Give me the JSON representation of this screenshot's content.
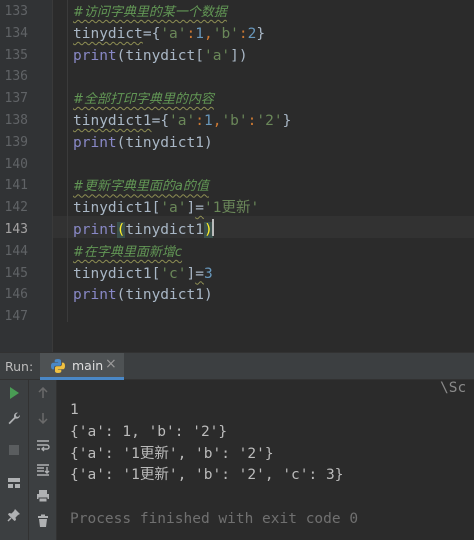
{
  "editor": {
    "lines": [
      {
        "num": "133",
        "tokens": [
          {
            "t": "#访问字典里的某一个数据",
            "c": "comment wavy"
          }
        ]
      },
      {
        "num": "134",
        "tokens": [
          {
            "t": "tinydict",
            "c": "ident wavy"
          },
          {
            "t": "=",
            "c": "op"
          },
          {
            "t": "{",
            "c": "op"
          },
          {
            "t": "'a'",
            "c": "str"
          },
          {
            "t": ":",
            "c": "punc"
          },
          {
            "t": "1",
            "c": "num"
          },
          {
            "t": ",",
            "c": "punc"
          },
          {
            "t": "'b'",
            "c": "str"
          },
          {
            "t": ":",
            "c": "punc"
          },
          {
            "t": "2",
            "c": "num"
          },
          {
            "t": "}",
            "c": "op"
          }
        ]
      },
      {
        "num": "135",
        "tokens": [
          {
            "t": "print",
            "c": "builtin"
          },
          {
            "t": "(",
            "c": "op"
          },
          {
            "t": "tinydict",
            "c": "ident"
          },
          {
            "t": "[",
            "c": "op"
          },
          {
            "t": "'a'",
            "c": "str"
          },
          {
            "t": "])",
            "c": "op"
          }
        ]
      },
      {
        "num": "136",
        "tokens": []
      },
      {
        "num": "137",
        "tokens": [
          {
            "t": "#全部打印字典里的内容",
            "c": "comment wavy"
          }
        ]
      },
      {
        "num": "138",
        "tokens": [
          {
            "t": "tinydict1",
            "c": "ident wavy"
          },
          {
            "t": "=",
            "c": "op"
          },
          {
            "t": "{",
            "c": "op"
          },
          {
            "t": "'a'",
            "c": "str"
          },
          {
            "t": ":",
            "c": "punc"
          },
          {
            "t": "1",
            "c": "num"
          },
          {
            "t": ",",
            "c": "punc"
          },
          {
            "t": "'b'",
            "c": "str"
          },
          {
            "t": ":",
            "c": "punc"
          },
          {
            "t": "'2'",
            "c": "str"
          },
          {
            "t": "}",
            "c": "op"
          }
        ]
      },
      {
        "num": "139",
        "tokens": [
          {
            "t": "print",
            "c": "builtin"
          },
          {
            "t": "(",
            "c": "op"
          },
          {
            "t": "tinydict1",
            "c": "ident"
          },
          {
            "t": ")",
            "c": "op"
          }
        ]
      },
      {
        "num": "140",
        "tokens": []
      },
      {
        "num": "141",
        "tokens": [
          {
            "t": "#更新字典里面的a的值",
            "c": "comment wavy"
          }
        ]
      },
      {
        "num": "142",
        "tokens": [
          {
            "t": "tinydict1",
            "c": "ident"
          },
          {
            "t": "[",
            "c": "op"
          },
          {
            "t": "'a'",
            "c": "str"
          },
          {
            "t": "]",
            "c": "op"
          },
          {
            "t": "=",
            "c": "op wavy"
          },
          {
            "t": "'1更新'",
            "c": "str"
          }
        ]
      },
      {
        "num": "143",
        "tokens": [
          {
            "t": "print",
            "c": "builtin"
          },
          {
            "t": "(",
            "c": "op brace"
          },
          {
            "t": "tinydict1",
            "c": "ident"
          },
          {
            "t": ")",
            "c": "op brace"
          }
        ]
      },
      {
        "num": "144",
        "tokens": [
          {
            "t": "#在字典里面新增c",
            "c": "comment wavy"
          }
        ]
      },
      {
        "num": "145",
        "tokens": [
          {
            "t": "tinydict1",
            "c": "ident"
          },
          {
            "t": "[",
            "c": "op"
          },
          {
            "t": "'c'",
            "c": "str"
          },
          {
            "t": "]",
            "c": "op"
          },
          {
            "t": "=",
            "c": "op wavy"
          },
          {
            "t": "3",
            "c": "num"
          }
        ]
      },
      {
        "num": "146",
        "tokens": [
          {
            "t": "print",
            "c": "builtin"
          },
          {
            "t": "(",
            "c": "op"
          },
          {
            "t": "tinydict1",
            "c": "ident"
          },
          {
            "t": ")",
            "c": "op"
          }
        ]
      },
      {
        "num": "147",
        "tokens": []
      }
    ],
    "current_line": "143"
  },
  "run_panel": {
    "label": "Run:",
    "tab_label": "main",
    "tab_close": "×",
    "top_right_fragment": "\\Sc",
    "console": [
      "1",
      "{'a': 1, 'b': '2'}",
      "{'a': '1更新', 'b': '2'}",
      "{'a': '1更新', 'b': '2', 'c': 3}",
      "",
      "Process finished with exit code 0"
    ]
  },
  "icons": {
    "run": "play-icon",
    "up": "arrow-up-icon",
    "down": "arrow-down-icon",
    "settings": "wrench-icon",
    "stop": "stop-icon",
    "wrap": "soft-wrap-icon",
    "scroll": "scroll-to-end-icon",
    "layout": "layout-icon",
    "print": "print-icon",
    "pin": "pin-icon",
    "delete": "trash-icon"
  },
  "colors": {
    "accent": "#4a88c7",
    "run_green": "#499c54"
  }
}
